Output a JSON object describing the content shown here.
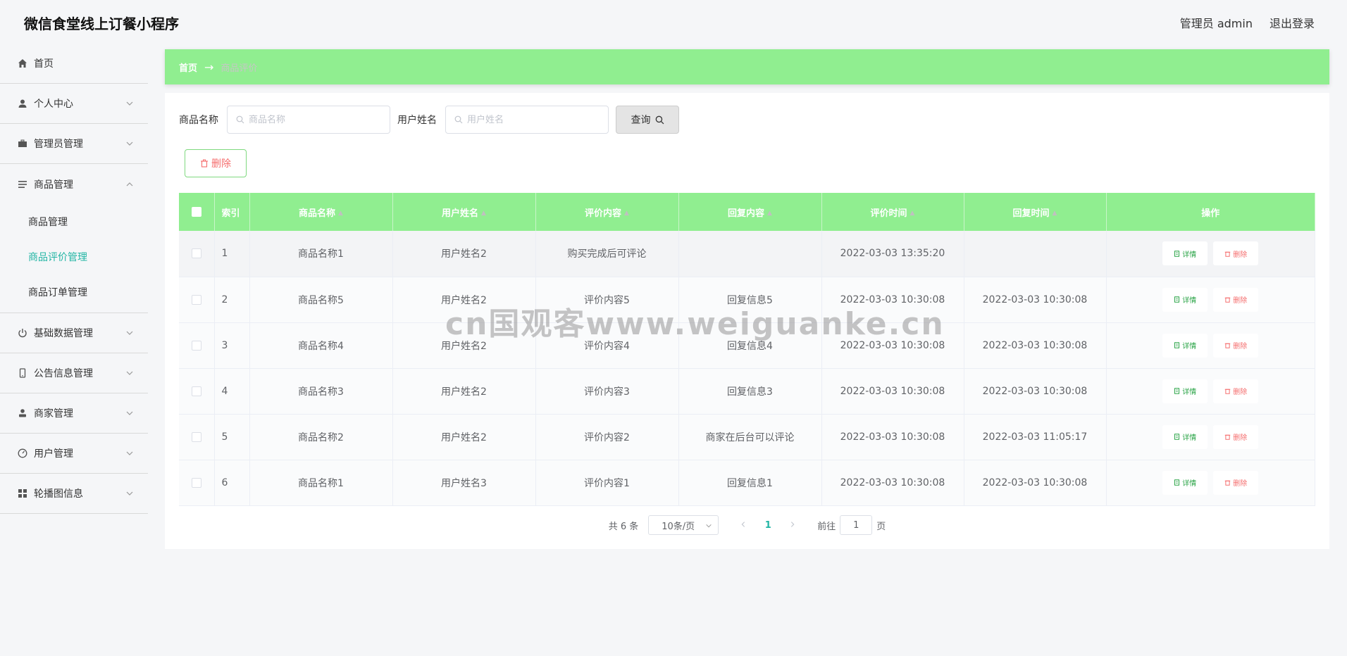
{
  "header": {
    "app_title": "微信食堂线上订餐小程序",
    "admin_label": "管理员 admin",
    "logout_label": "退出登录"
  },
  "sidebar": {
    "items": [
      {
        "label": "首页",
        "icon": "home-icon"
      },
      {
        "label": "个人中心",
        "icon": "user-icon"
      },
      {
        "label": "管理员管理",
        "icon": "briefcase-icon"
      },
      {
        "label": "商品管理",
        "icon": "list-icon"
      },
      {
        "label": "基础数据管理",
        "icon": "power-icon"
      },
      {
        "label": "公告信息管理",
        "icon": "phone-icon"
      },
      {
        "label": "商家管理",
        "icon": "person-icon"
      },
      {
        "label": "用户管理",
        "icon": "dashboard-icon"
      },
      {
        "label": "轮播图信息",
        "icon": "grid-icon"
      }
    ],
    "submenu": [
      {
        "label": "商品管理"
      },
      {
        "label": "商品评价管理"
      },
      {
        "label": "商品订单管理"
      }
    ],
    "active_color": "#22b5a4"
  },
  "breadcrumb": {
    "home": "首页",
    "arrow": "→",
    "current": "商品评价"
  },
  "search": {
    "product_label": "商品名称",
    "product_placeholder": "商品名称",
    "user_label": "用户姓名",
    "user_placeholder": "用户姓名",
    "query_label": "查询"
  },
  "toolbar": {
    "delete_label": "删除"
  },
  "table": {
    "columns": [
      "索引",
      "商品名称",
      "用户姓名",
      "评价内容",
      "回复内容",
      "评价时间",
      "回复时间",
      "操作"
    ],
    "rows": [
      {
        "idx": "1",
        "product": "商品名称1",
        "user": "用户姓名2",
        "content": "购买完成后可评论",
        "reply": "",
        "eval_time": "2022-03-03 13:35:20",
        "reply_time": ""
      },
      {
        "idx": "2",
        "product": "商品名称5",
        "user": "用户姓名2",
        "content": "评价内容5",
        "reply": "回复信息5",
        "eval_time": "2022-03-03 10:30:08",
        "reply_time": "2022-03-03 10:30:08"
      },
      {
        "idx": "3",
        "product": "商品名称4",
        "user": "用户姓名2",
        "content": "评价内容4",
        "reply": "回复信息4",
        "eval_time": "2022-03-03 10:30:08",
        "reply_time": "2022-03-03 10:30:08"
      },
      {
        "idx": "4",
        "product": "商品名称3",
        "user": "用户姓名2",
        "content": "评价内容3",
        "reply": "回复信息3",
        "eval_time": "2022-03-03 10:30:08",
        "reply_time": "2022-03-03 10:30:08"
      },
      {
        "idx": "5",
        "product": "商品名称2",
        "user": "用户姓名2",
        "content": "评价内容2",
        "reply": "商家在后台可以评论",
        "eval_time": "2022-03-03 10:30:08",
        "reply_time": "2022-03-03 11:05:17"
      },
      {
        "idx": "6",
        "product": "商品名称1",
        "user": "用户姓名3",
        "content": "评价内容1",
        "reply": "回复信息1",
        "eval_time": "2022-03-03 10:30:08",
        "reply_time": "2022-03-03 10:30:08"
      }
    ],
    "detail_label": "详情",
    "delete_label": "删除",
    "header_color": "#90ee90"
  },
  "pagination": {
    "total": "共 6 条",
    "page_size": "10条/页",
    "current_page": "1",
    "goto_prefix": "前往",
    "goto_value": "1",
    "goto_suffix": "页"
  },
  "watermark": "cn国观客www.weiguanke.cn"
}
